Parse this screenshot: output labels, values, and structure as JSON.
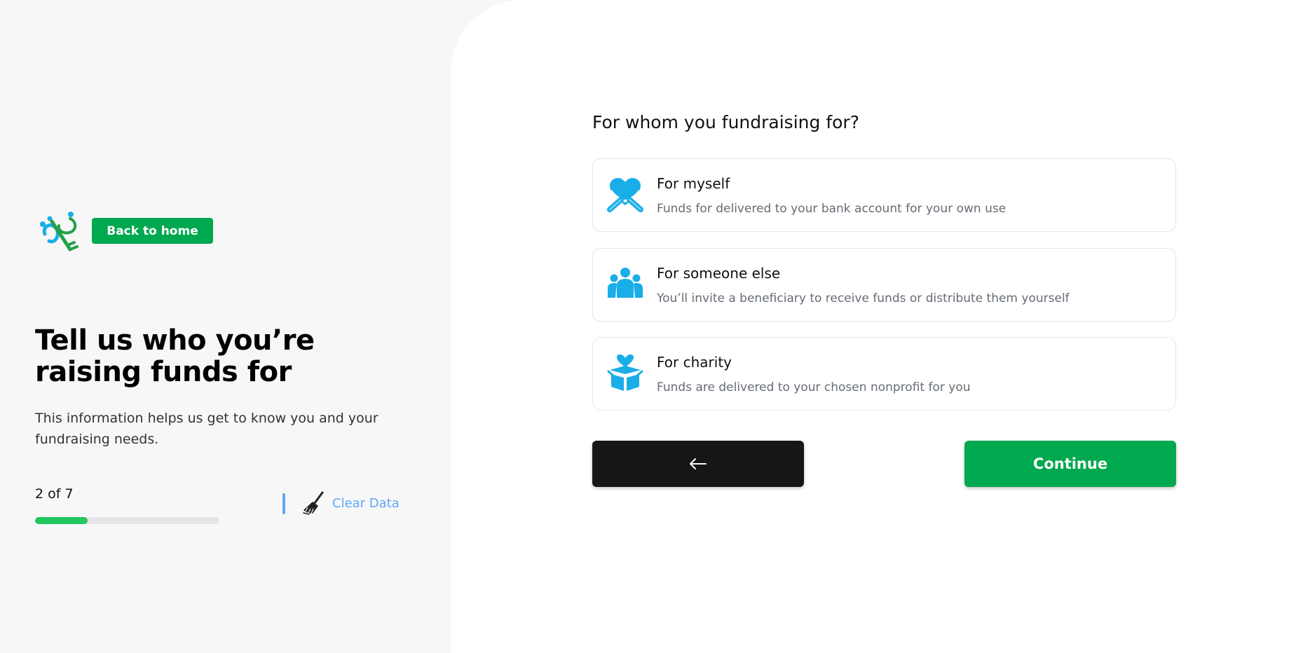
{
  "sidebar": {
    "back_home_label": "Back to home",
    "title": "Tell us who you’re raising funds for",
    "subtitle": "This information helps us get to know you and your fundraising needs.",
    "step_label": "2 of 7",
    "progress": 0.2857,
    "clear_label": "Clear Data"
  },
  "main": {
    "question": "For whom you fundraising for?",
    "options": [
      {
        "title": "For myself",
        "description": "Funds for delivered to your bank account for your own use",
        "icon": "heart-hug-icon"
      },
      {
        "title": "For someone else",
        "description": "You’ll invite a beneficiary to receive funds or distribute them yourself",
        "icon": "people-group-icon"
      },
      {
        "title": "For charity",
        "description": "Funds are delivered to your chosen nonprofit for you",
        "icon": "charity-box-icon"
      }
    ],
    "back_icon": "arrow-left-icon",
    "continue_label": "Continue"
  },
  "colors": {
    "brand_green": "#00a84f",
    "progress_green": "#22c55e",
    "icon_blue": "#1aaee8",
    "link_blue": "#60a5fa",
    "dark_button": "#161616"
  }
}
